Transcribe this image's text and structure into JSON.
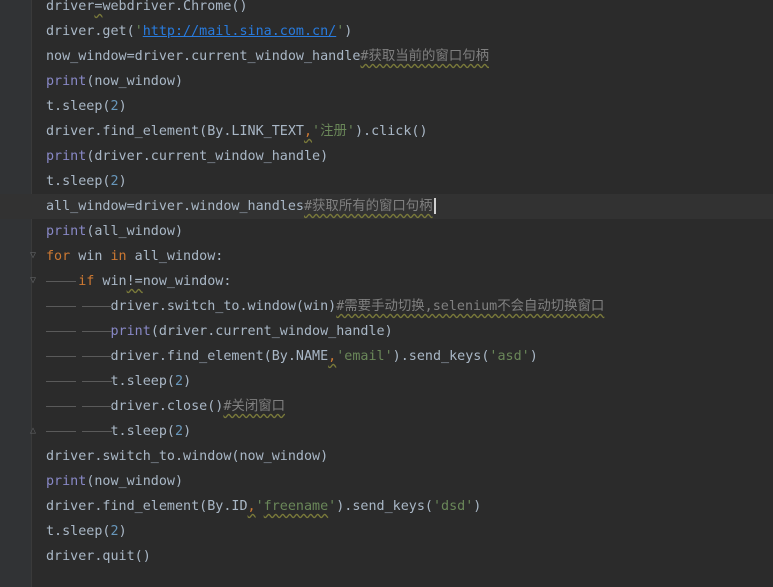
{
  "editor": {
    "language": "python",
    "lines": [
      {
        "id": "l1",
        "text": "driver=webdriver.Chrome()"
      },
      {
        "id": "l2",
        "text": "driver.get('http://mail.sina.com.cn/')"
      },
      {
        "id": "l3",
        "text": "now_window=driver.current_window_handle#获取当前的窗口句柄"
      },
      {
        "id": "l4",
        "text": "print(now_window)"
      },
      {
        "id": "l5",
        "text": "t.sleep(2)"
      },
      {
        "id": "l6",
        "text": "driver.find_element(By.LINK_TEXT,'注册').click()"
      },
      {
        "id": "l7",
        "text": "print(driver.current_window_handle)"
      },
      {
        "id": "l8",
        "text": "t.sleep(2)"
      },
      {
        "id": "l9",
        "text": "all_window=driver.window_handles#获取所有的窗口句柄"
      },
      {
        "id": "l10",
        "text": "print(all_window)"
      },
      {
        "id": "l11",
        "text": "for win in all_window:"
      },
      {
        "id": "l12",
        "text": "    if win!=now_window:"
      },
      {
        "id": "l13",
        "text": "        driver.switch_to.window(win)#需要手动切换,selenium不会自动切换窗口"
      },
      {
        "id": "l14",
        "text": "        print(driver.current_window_handle)"
      },
      {
        "id": "l15",
        "text": "        driver.find_element(By.NAME,'email').send_keys('asd')"
      },
      {
        "id": "l16",
        "text": "        t.sleep(2)"
      },
      {
        "id": "l17",
        "text": "        driver.close()#关闭窗口"
      },
      {
        "id": "l18",
        "text": "        t.sleep(2)"
      },
      {
        "id": "l19",
        "text": "driver.switch_to.window(now_window)"
      },
      {
        "id": "l20",
        "text": "print(now_window)"
      },
      {
        "id": "l21",
        "text": "driver.find_element(By.ID,'freename').send_keys('dsd')"
      },
      {
        "id": "l22",
        "text": "t.sleep(2)"
      },
      {
        "id": "l23",
        "text": "driver.quit()"
      }
    ],
    "current_line": "l9",
    "colors": {
      "background": "#2b2b2b",
      "gutter": "#313335",
      "keyword": "#cc7832",
      "builtin": "#8888c6",
      "string": "#6a8759",
      "number": "#6897bb",
      "comment": "#808080",
      "default": "#a9b7c6"
    }
  }
}
